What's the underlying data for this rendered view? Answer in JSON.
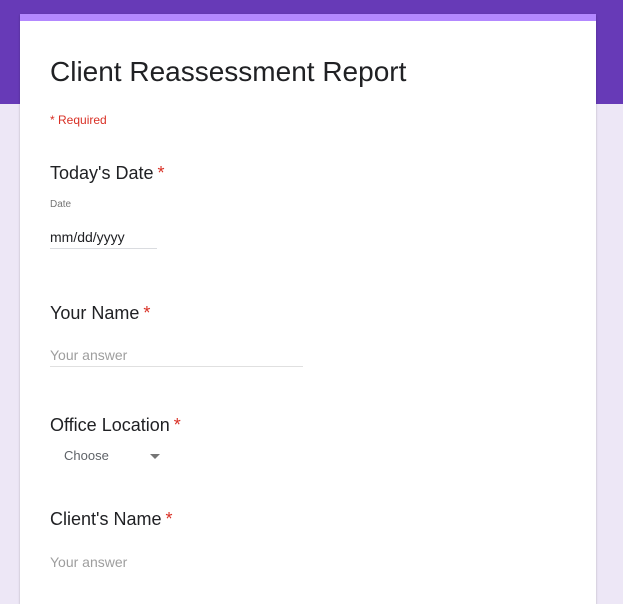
{
  "theme": {
    "header_color": "#673ab7",
    "accent_strip_color": "#b388ff",
    "background_color": "#ede7f6",
    "required_color": "#d93025"
  },
  "form": {
    "title": "Client Reassessment Report",
    "required_note": "* Required"
  },
  "questions": [
    {
      "title": "Today's Date",
      "required_marker": "*",
      "type": "date",
      "caption": "Date",
      "value": "mm/dd/yyyy"
    },
    {
      "title": "Your Name",
      "required_marker": "*",
      "type": "text",
      "placeholder": "Your answer"
    },
    {
      "title": "Office Location",
      "required_marker": "*",
      "type": "dropdown",
      "selected": "Choose",
      "icon": "arrow-drop-down-icon"
    },
    {
      "title": "Client's Name",
      "required_marker": "*",
      "type": "text",
      "placeholder": "Your answer"
    }
  ]
}
